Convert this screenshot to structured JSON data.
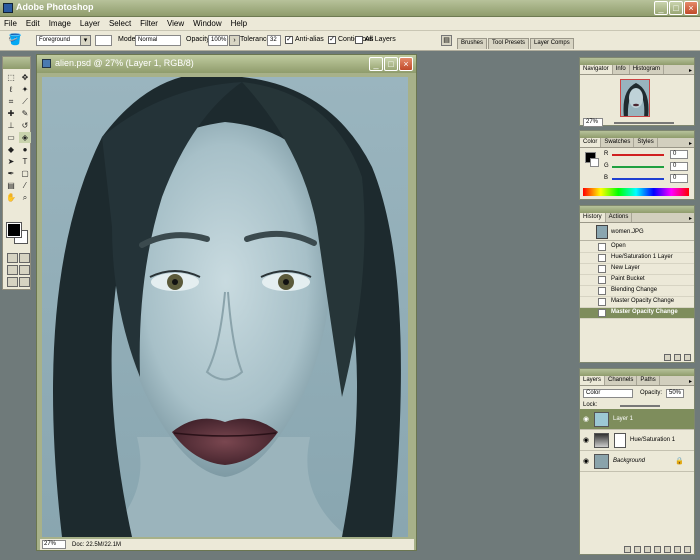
{
  "app": {
    "title": "Adobe Photoshop"
  },
  "window_buttons": {
    "minimize": "_",
    "maximize": "□",
    "close": "×"
  },
  "menu": [
    "File",
    "Edit",
    "Image",
    "Layer",
    "Select",
    "Filter",
    "View",
    "Window",
    "Help"
  ],
  "options": {
    "fill_source": "Foreground",
    "mode_label": "Mode:",
    "mode_value": "Normal",
    "opacity_label": "Opacity:",
    "opacity_value": "100%",
    "tolerance_label": "Tolerance:",
    "tolerance_value": "32",
    "antialias_label": "Anti-alias",
    "contiguous_label": "Contiguous",
    "all_layers_label": "All Layers",
    "palette_well_tabs": [
      "Brushes",
      "Tool Presets",
      "Layer Comps"
    ]
  },
  "document": {
    "title": "alien.psd @ 27% (Layer 1, RGB/8)",
    "zoom": "27%",
    "doc_info": "Doc: 22.5M/22.1M"
  },
  "navigator": {
    "tabs": [
      "Navigator",
      "Info",
      "Histogram"
    ],
    "zoom": "27%"
  },
  "color": {
    "tabs": [
      "Color",
      "Swatches",
      "Styles"
    ],
    "channels": [
      {
        "label": "R",
        "value": "0",
        "color": "#d02020"
      },
      {
        "label": "G",
        "value": "0",
        "color": "#20a040"
      },
      {
        "label": "B",
        "value": "0",
        "color": "#2040d0"
      }
    ]
  },
  "history": {
    "tabs": [
      "History",
      "Actions"
    ],
    "snapshot": "women.JPG",
    "states": [
      "Open",
      "Hue/Saturation 1 Layer",
      "New Layer",
      "Paint Bucket",
      "Blending Change",
      "Master Opacity Change",
      "Master Opacity Change"
    ],
    "selected_index": 6
  },
  "layers": {
    "tabs": [
      "Layers",
      "Channels",
      "Paths"
    ],
    "blend_mode": "Color",
    "opacity_label": "Opacity:",
    "opacity_value": "50%",
    "lock_label": "Lock:",
    "items": [
      {
        "name": "Layer 1",
        "selected": true
      },
      {
        "name": "Hue/Saturation 1",
        "selected": false
      },
      {
        "name": "Background",
        "selected": false
      }
    ]
  },
  "icons": {
    "menu_arrow": "▸",
    "eye": "◉",
    "paint_bucket": "bucket-icon"
  }
}
